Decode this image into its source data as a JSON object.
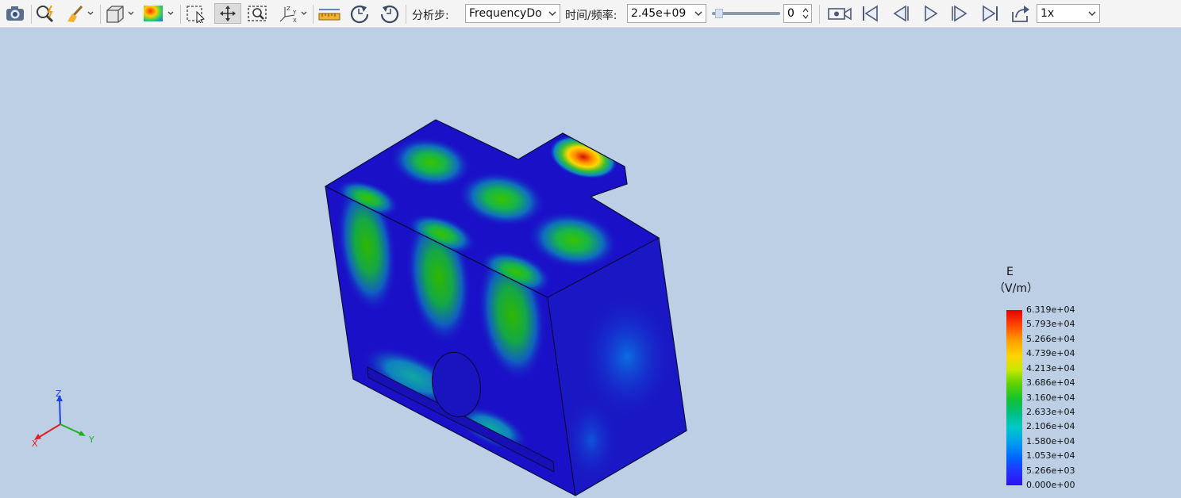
{
  "toolbar": {
    "analysis_step_label": "分析步:",
    "analysis_step_value": "FrequencyDo",
    "time_freq_label": "时间/频率:",
    "time_freq_value": "2.45e+09",
    "frame_index": "0",
    "slider_level": 0.05,
    "playback_speed": "1x",
    "icons": [
      "camera-icon",
      "query-icon",
      "brush-icon",
      "cube-view-icon",
      "contour-icon",
      "select-icon",
      "pan-icon",
      "zoom-box-icon",
      "axes-icon",
      "ruler-icon",
      "rotate-cw-icon",
      "rotate-ccw-icon",
      "record-icon",
      "first-frame-icon",
      "prev-frame-icon",
      "play-icon",
      "next-frame-icon",
      "last-frame-icon",
      "export-icon"
    ]
  },
  "legend": {
    "quantity": "E",
    "unit_open": "（",
    "unit": "V/m",
    "unit_close": "）",
    "ticks": [
      "6.319e+04",
      "5.793e+04",
      "5.266e+04",
      "4.739e+04",
      "4.213e+04",
      "3.686e+04",
      "3.160e+04",
      "2.633e+04",
      "2.106e+04",
      "1.580e+04",
      "1.053e+04",
      "5.266e+03",
      "0.000e+00"
    ],
    "colors": [
      "#e60000",
      "#ff9a00",
      "#ffd400",
      "#5fd200",
      "#13c230",
      "#00bf85",
      "#00c8c8",
      "#009cf0",
      "#0066ff",
      "#2c10f0"
    ]
  },
  "triad": {
    "z": "Z",
    "x": "X",
    "y": "Y",
    "colors": {
      "x": "#e02020",
      "y": "#20b020",
      "z": "#2040e0"
    }
  },
  "colors": {
    "background": "#bccfe5",
    "toolbar": "#f4f4f4",
    "field_low": "#1a10c8",
    "field_high": "#d01000"
  }
}
